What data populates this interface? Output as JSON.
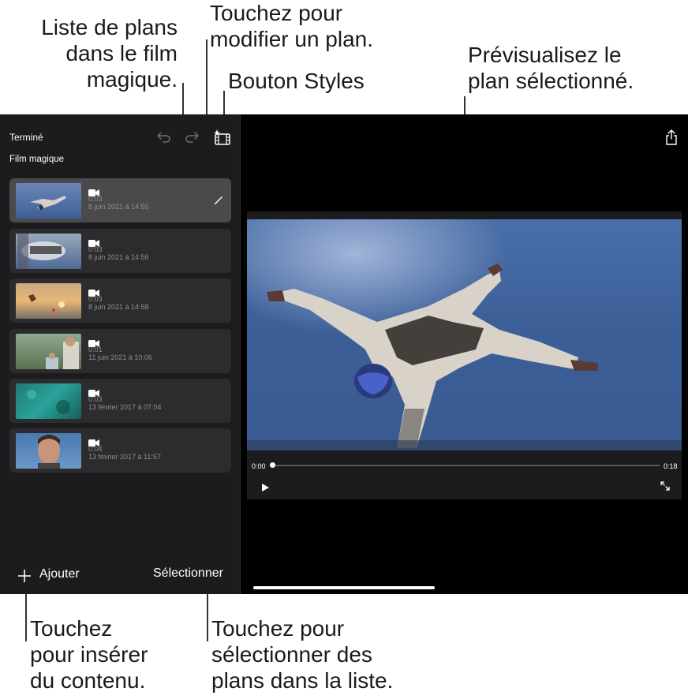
{
  "callouts": {
    "list": [
      "Liste de plans",
      "dans le film",
      "magique."
    ],
    "edit": [
      "Touchez pour",
      "modifier un plan."
    ],
    "styles": "Bouton Styles",
    "preview": [
      "Prévisualisez le",
      "plan sélectionné."
    ],
    "insert": [
      "Touchez",
      "pour insérer",
      "du contenu."
    ],
    "select": [
      "Touchez pour",
      "sélectionner des",
      "plans dans la liste."
    ]
  },
  "sidebar": {
    "done_label": "Terminé",
    "title": "Film magique",
    "clips": [
      {
        "duration": "0:03",
        "date": "8 juin 2021 à 14:55",
        "selected": true
      },
      {
        "duration": "0:03",
        "date": "8 juin 2021 à 14:56",
        "selected": false
      },
      {
        "duration": "0:03",
        "date": "8 juin 2021 à 14:58",
        "selected": false
      },
      {
        "duration": "0:01",
        "date": "11 juin 2021 à 10:06",
        "selected": false
      },
      {
        "duration": "0:03",
        "date": "13 février 2017 à 07:04",
        "selected": false
      },
      {
        "duration": "0:04",
        "date": "13 février 2017 à 11:57",
        "selected": false
      }
    ],
    "add_label": "Ajouter",
    "select_label": "Sélectionner"
  },
  "player": {
    "current_time": "0:00",
    "total_time": "0:18",
    "progress": 0
  },
  "colors": {
    "screen_bg": "#000000",
    "sidebar_bg": "#1c1c1e",
    "clip_bg": "#2c2c2e",
    "clip_selected_bg": "#4a4a4c",
    "sky": "#3c5f98"
  },
  "icons": [
    "undo-icon",
    "redo-icon",
    "styles-icon",
    "share-icon",
    "camera-icon",
    "pencil-icon",
    "plus-icon",
    "play-icon",
    "fullscreen-icon"
  ]
}
